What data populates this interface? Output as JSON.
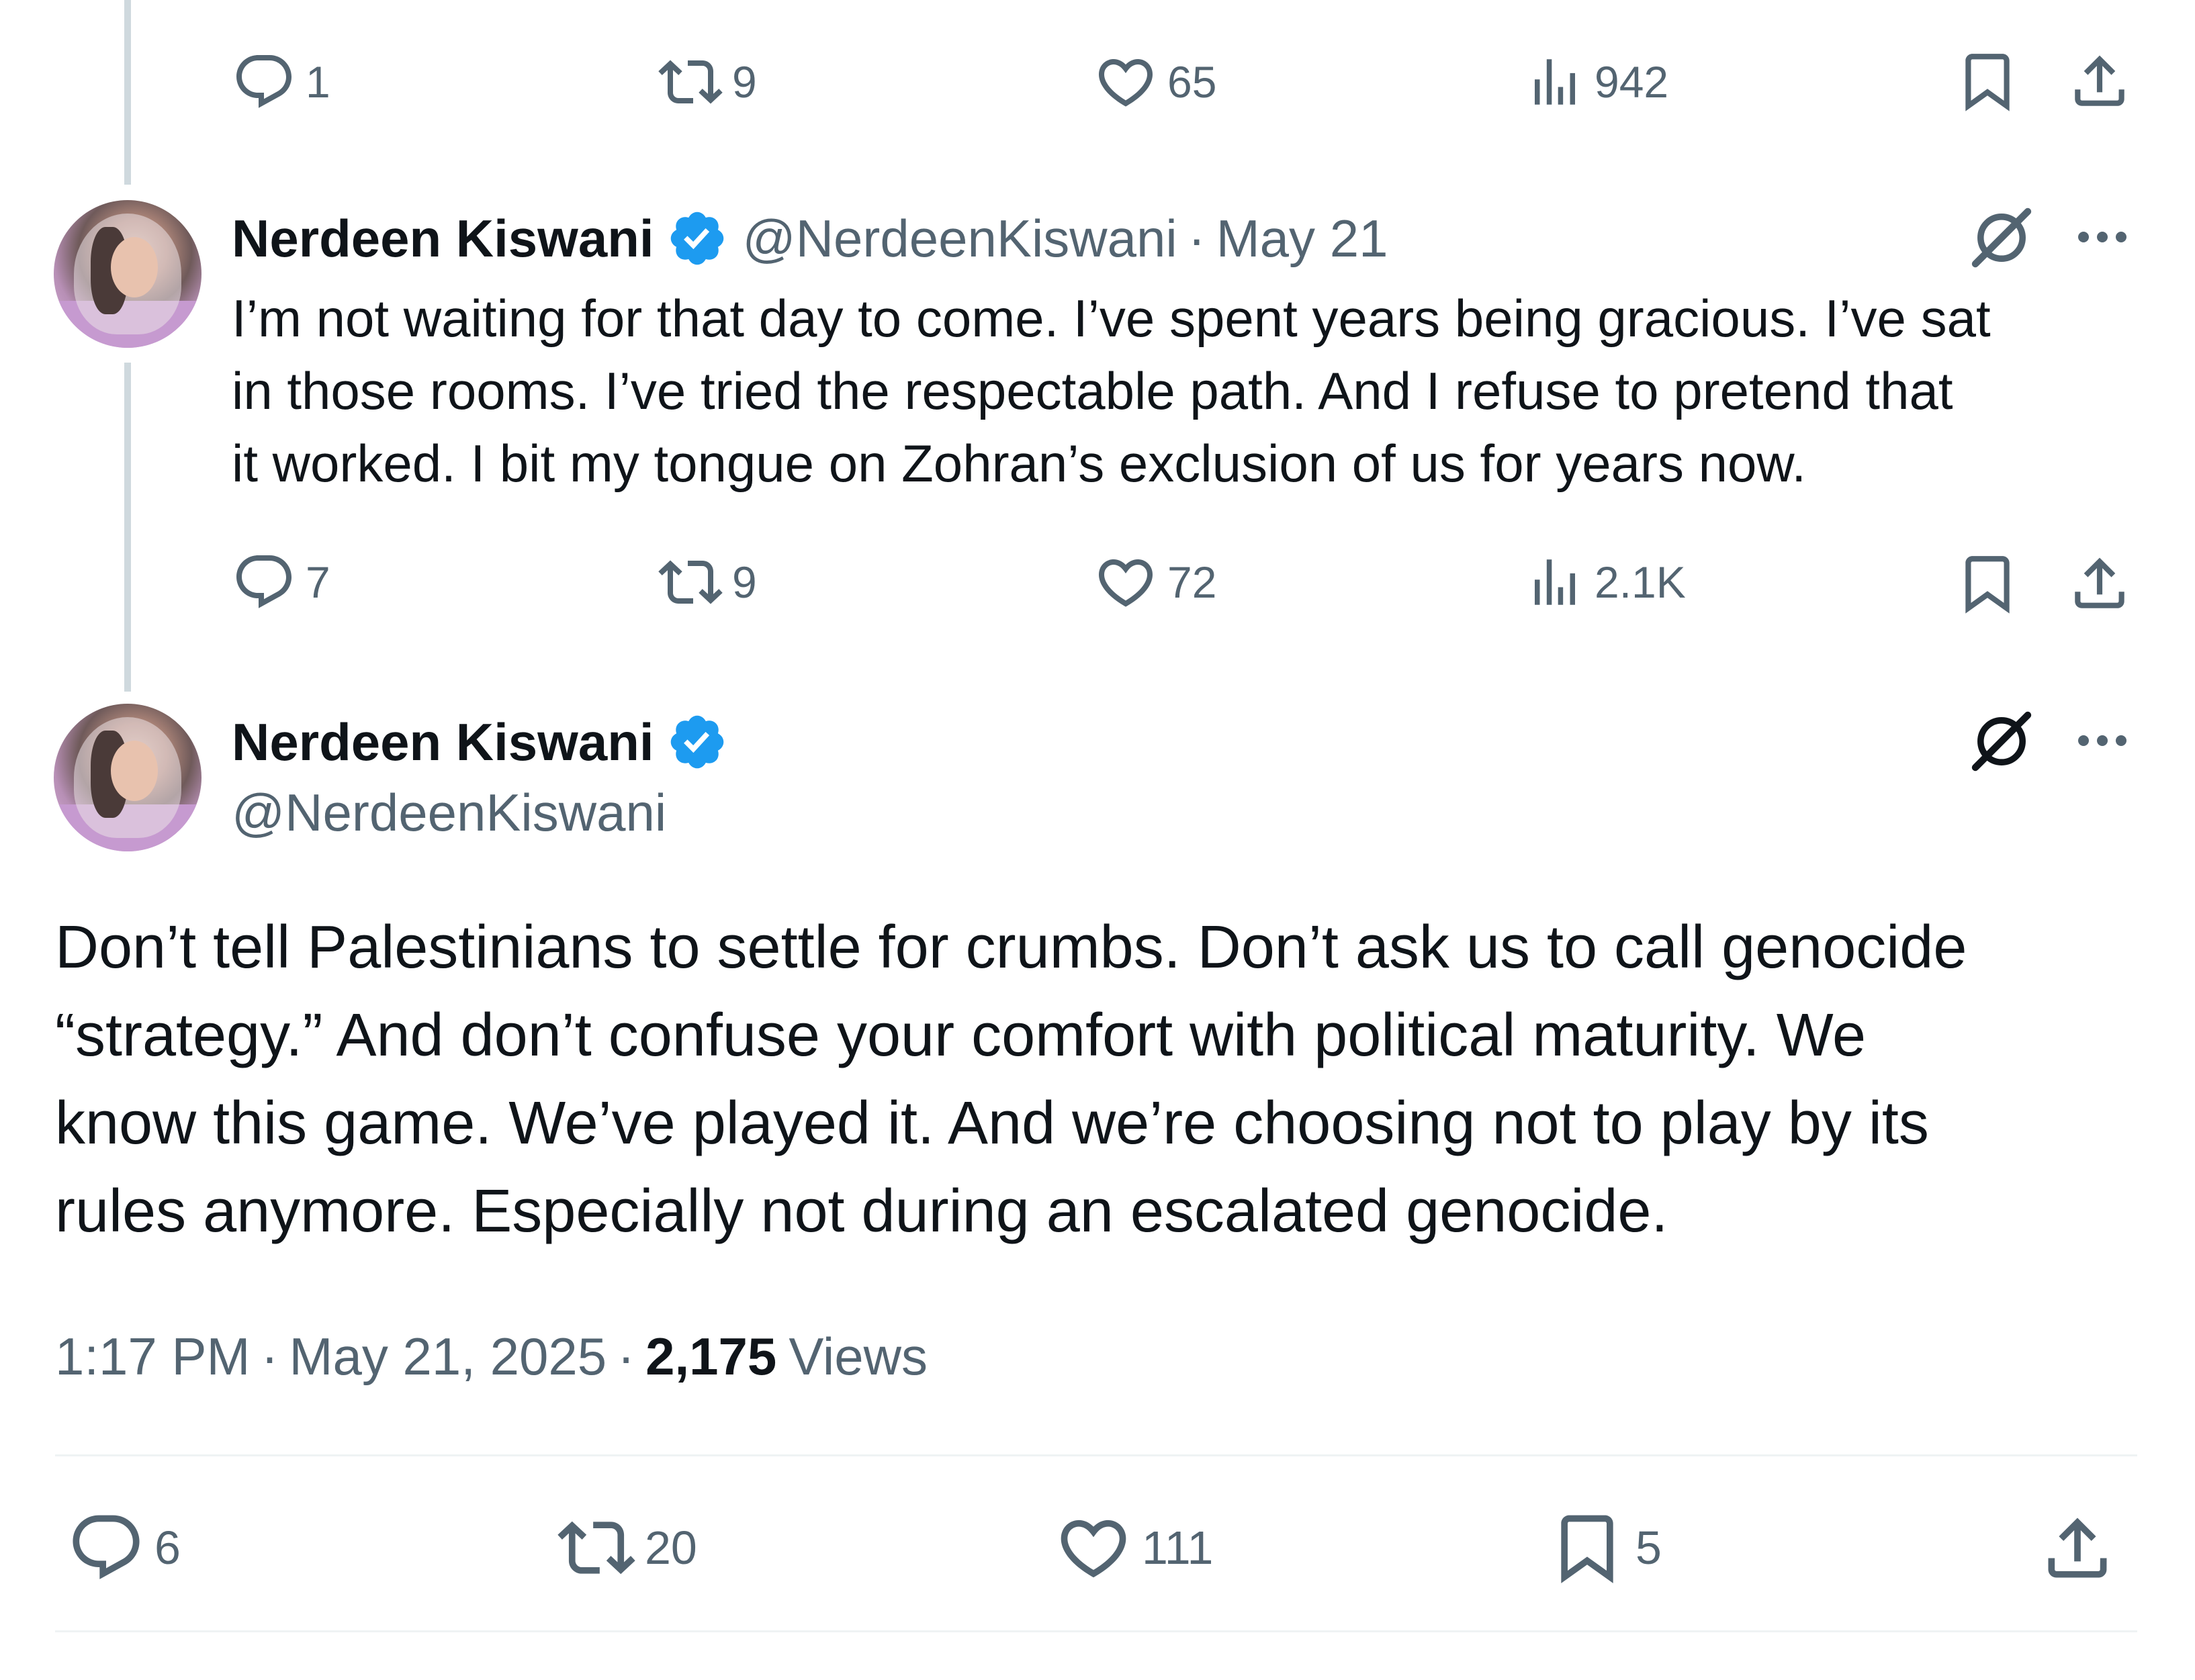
{
  "tweet_prev": {
    "actions": {
      "replies": "1",
      "reposts": "9",
      "likes": "65",
      "views": "942"
    }
  },
  "tweet_reply": {
    "name": "Nerdeen Kiswani",
    "handle": "@NerdeenKiswani",
    "date": "May 21",
    "text": "I’m not waiting for that day to come. I’ve spent years being gracious. I’ve sat in those rooms. I’ve tried the respectable path. And I refuse to pretend that it worked. I bit my tongue on Zohran’s exclusion of us for years now.",
    "lines": [
      "I’m not waiting for that day to come. I’ve spent years being gracious. I’ve sat",
      "in those rooms. I’ve tried the respectable path. And I refuse to pretend that",
      "it worked. I bit my tongue on Zohran’s exclusion of us for years now."
    ],
    "actions": {
      "replies": "7",
      "reposts": "9",
      "likes": "72",
      "views": "2.1K"
    }
  },
  "tweet_main": {
    "name": "Nerdeen Kiswani",
    "handle": "@NerdeenKiswani",
    "lines": [
      "Don’t tell Palestinians to settle for crumbs. Don’t ask us to call genocide",
      "“strategy.” And don’t confuse your comfort with political maturity. We",
      "know this game. We’ve played it. And we’re choosing not to play by its",
      "rules anymore. Especially not during an escalated genocide."
    ],
    "time": "1:17 PM",
    "date": "May 21, 2025",
    "views_count": "2,175",
    "views_label": "Views",
    "actions": {
      "replies": "6",
      "reposts": "20",
      "likes": "111",
      "bookmarks": "5"
    }
  },
  "colors": {
    "text": "#0f1419",
    "muted": "#536471",
    "verified": "#1d9bf0",
    "divider": "#eff3f4",
    "thread": "#cfd9de"
  },
  "icons": [
    "reply-icon",
    "repost-icon",
    "like-icon",
    "views-icon",
    "bookmark-icon",
    "share-icon",
    "verified-badge-icon",
    "grok-icon",
    "more-icon"
  ]
}
